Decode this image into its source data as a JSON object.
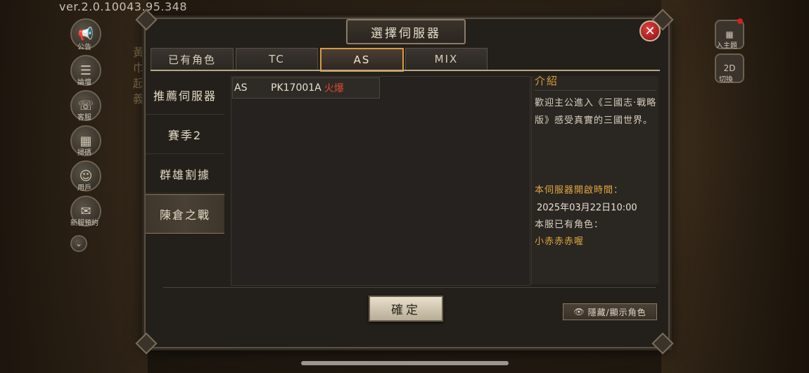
{
  "version": "ver.2.0.10043.95.348",
  "left_sidebar": [
    {
      "label": "公告",
      "icon": "megaphone-icon"
    },
    {
      "label": "論壇",
      "icon": "forum-icon"
    },
    {
      "label": "客服",
      "icon": "service-icon"
    },
    {
      "label": "掃碼",
      "icon": "scan-icon"
    },
    {
      "label": "用戶",
      "icon": "user-icon"
    },
    {
      "label": "新服預約",
      "icon": "reserve-icon"
    }
  ],
  "right_sidebar": [
    {
      "label": "入主題",
      "icon": "grid-icon"
    },
    {
      "label": "切換",
      "icon": "2d-3d-icon",
      "badge": "2D"
    }
  ],
  "background_vertical_text": "黃巾起義",
  "dialog": {
    "title": "選擇伺服器",
    "close_symbol": "✕",
    "tabs": [
      "已有角色",
      "TC",
      "AS",
      "MIX"
    ],
    "active_tab": "AS",
    "menu": [
      "推薦伺服器",
      "賽季2",
      "群雄割據",
      "陳倉之戰"
    ],
    "active_menu": "陳倉之戰",
    "servers": [
      {
        "region": "AS",
        "name": "PK17001A",
        "status": "火爆",
        "status_color": "#e04838"
      }
    ],
    "info": {
      "title": "介紹",
      "description": "歡迎主公進入《三國志·戰略版》感受真實的三國世界。",
      "open_time_label": "本伺服器開啟時間：",
      "open_time": "2025年03月22日10:00",
      "characters_label": "本服已有角色：",
      "character_name": "小赤赤赤喔"
    },
    "confirm_label": "確定",
    "toggle_label": "隱藏/顯示角色"
  },
  "colors": {
    "accent": "#d99a40",
    "hot": "#e04838",
    "gold_text": "#e0a840"
  }
}
